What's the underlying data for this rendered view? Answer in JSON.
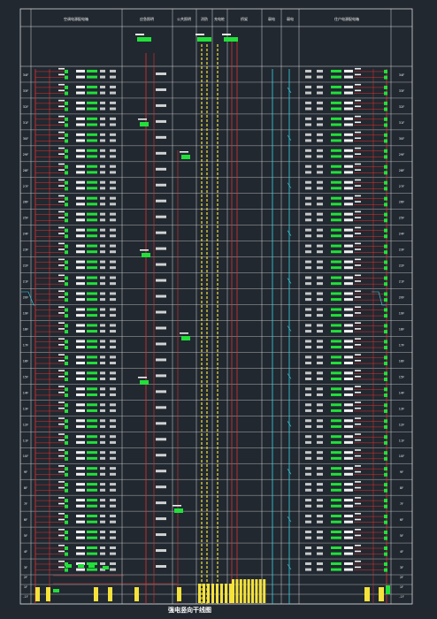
{
  "drawing": {
    "background": "#212830",
    "frame_color": "#d8d8d8",
    "title": "强电竖向干线图",
    "header_columns": [
      "空调电源配电箱",
      "应急照明",
      "公共照明",
      "消防",
      "充电桩",
      "桥架",
      "弱电",
      "弱电",
      "住户电源配电箱"
    ]
  },
  "floors": [
    "34F",
    "33F",
    "32F",
    "31F",
    "30F",
    "29F",
    "28F",
    "27F",
    "26F",
    "25F",
    "24F",
    "23F",
    "22F",
    "21F",
    "20F",
    "19F",
    "18F",
    "17F",
    "16F",
    "15F",
    "14F",
    "13F",
    "12F",
    "11F",
    "10F",
    "9F",
    "8F",
    "7F",
    "6F",
    "5F",
    "4F",
    "3F",
    "2F",
    "1F",
    "-1F"
  ],
  "labels": {
    "riser_tags": [
      "WL",
      "ZL",
      "AL",
      "WP",
      "ZP"
    ],
    "roof_tag": "RF"
  },
  "colors": {
    "green": "#22e03a",
    "yellow": "#f5e23b",
    "red": "#e23030",
    "cyan": "#3ad6e8",
    "white": "#f0f0f0",
    "gray": "#c8c8c8"
  },
  "icons": [
    "distribution-box-icon",
    "busbar-icon",
    "cable-tray-icon"
  ]
}
